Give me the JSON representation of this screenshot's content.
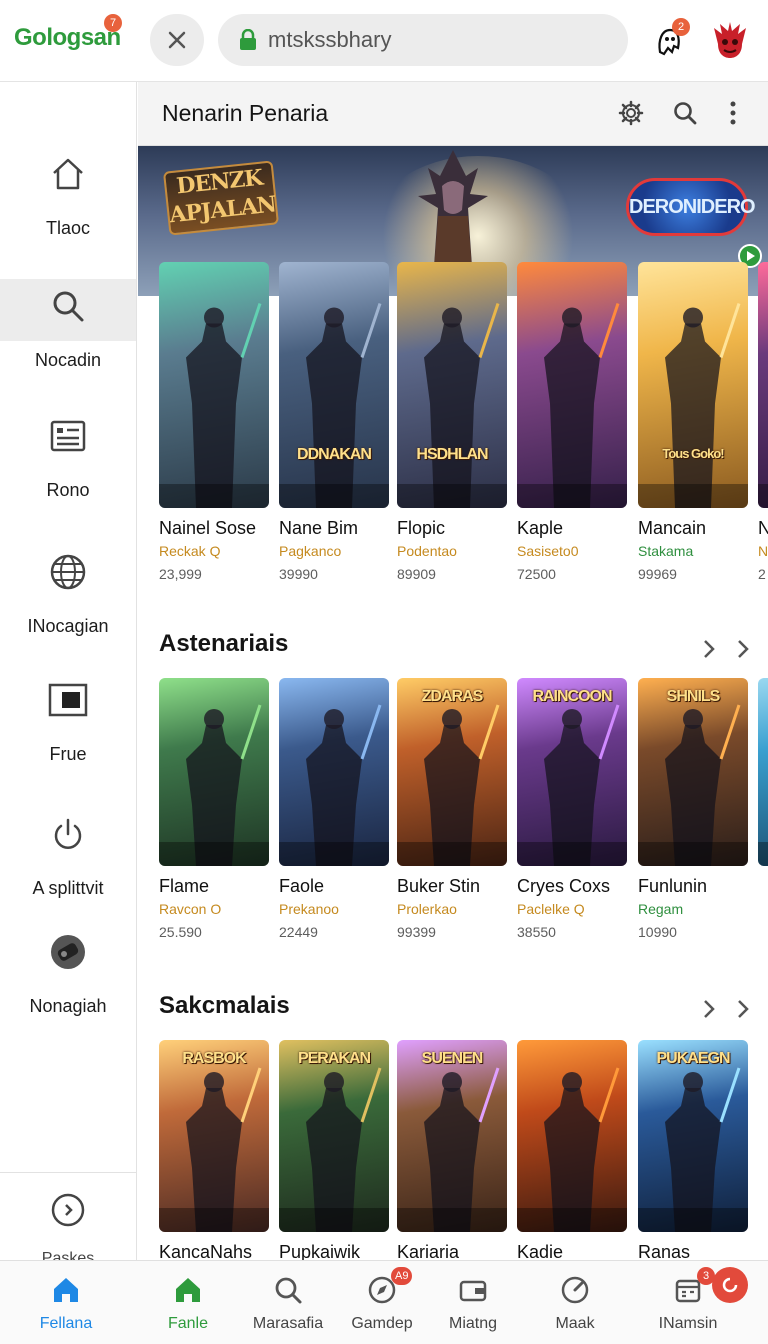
{
  "topbar": {
    "logo": "Gologsan",
    "logo_badge": "7",
    "url": "mtskssbhary",
    "notif_badge": "2"
  },
  "sidebar": {
    "items": [
      {
        "label": "Tlaoc",
        "icon": "home-icon"
      },
      {
        "label": "Nocadin",
        "icon": "search-icon"
      },
      {
        "label": "Rono",
        "icon": "list-card-icon"
      },
      {
        "label": "INocagian",
        "icon": "globe-icon"
      },
      {
        "label": "Frue",
        "icon": "window-icon"
      },
      {
        "label": "A splittvit",
        "icon": "power-icon"
      },
      {
        "label": "Nonagiah",
        "icon": "controller-icon"
      }
    ],
    "footer_label": "Paskes"
  },
  "header": {
    "title": "Nenarin Penaria"
  },
  "hero": {
    "logo_left": "DENZK APJALAN",
    "logo_right": "DERONIDERO"
  },
  "sections": [
    {
      "title": "",
      "cards": [
        {
          "title": "Nainel Sose",
          "sub": "Reckak Q",
          "count": "23,999",
          "art": "",
          "palette": [
            "#5a7c8f",
            "#2b3a48",
            "#62d1b2"
          ]
        },
        {
          "title": "Nane Bim",
          "sub": "Pagkanco",
          "count": "39990",
          "art": "DDNAKAN",
          "palette": [
            "#49607f",
            "#27344a",
            "#a0b4d0"
          ]
        },
        {
          "title": "Flopic",
          "sub": "Podentao",
          "count": "89909",
          "art": "HSDHLAN",
          "palette": [
            "#5e6a8c",
            "#2c2f46",
            "#e9b64a"
          ]
        },
        {
          "title": "Kaple",
          "sub": "Sasiseto0",
          "count": "72500",
          "art": "",
          "palette": [
            "#8a4a8e",
            "#35204a",
            "#ff8a3c"
          ]
        },
        {
          "title": "Mancain",
          "sub": "Stakama",
          "count": "99969",
          "art": "Tous Goko!",
          "palette": [
            "#f0b64a",
            "#8a5a20",
            "#ffe49a"
          ],
          "green": true
        },
        {
          "title": "N",
          "sub": "N",
          "count": "2",
          "art": "",
          "palette": [
            "#6a3a7c",
            "#301a40",
            "#ff6b9a"
          ]
        }
      ]
    },
    {
      "title": "Astenariais",
      "cards": [
        {
          "title": "Flame",
          "sub": "Ravcon O",
          "count": "25.590",
          "art": "",
          "palette": [
            "#3f7a4c",
            "#1e3424",
            "#8fe08a"
          ]
        },
        {
          "title": "Faole",
          "sub": "Prekanoo",
          "count": "22449",
          "art": "",
          "palette": [
            "#3b5a8c",
            "#1a2540",
            "#8ab8f0"
          ]
        },
        {
          "title": "Buker Stin",
          "sub": "Prolerkao",
          "count": "99399",
          "art": "ZDARAS",
          "palette": [
            "#c0602a",
            "#4a2414",
            "#ffcc66"
          ]
        },
        {
          "title": "Cryes Coxs",
          "sub": "Paclelke Q",
          "count": "38550",
          "art": "RAINCOON",
          "palette": [
            "#6a3a8c",
            "#2a1a40",
            "#d08aff"
          ]
        },
        {
          "title": "Funlunin",
          "sub": "Regam",
          "count": "10990",
          "art": "SHNILS",
          "palette": [
            "#7a4a2a",
            "#2a1e1a",
            "#ffb050"
          ],
          "green": true
        },
        {
          "title": "",
          "sub": "",
          "count": "",
          "art": "",
          "palette": [
            "#3aa0d0",
            "#1a4a6a",
            "#9ad8f0"
          ]
        }
      ]
    },
    {
      "title": "Sakcmalais",
      "cards": [
        {
          "title": "KancaNahs",
          "sub": "",
          "count": "",
          "art": "RASBOK",
          "palette": [
            "#c06a3a",
            "#4a2a24",
            "#ffd07a"
          ]
        },
        {
          "title": "Pupkaiwik",
          "sub": "",
          "count": "",
          "art": "PERAKAN",
          "palette": [
            "#3a6a3a",
            "#1e2a1e",
            "#e0c060"
          ]
        },
        {
          "title": "Kariaria",
          "sub": "",
          "count": "",
          "art": "SUENEN",
          "palette": [
            "#8a5a3a",
            "#3a2418",
            "#e0a0ff"
          ]
        },
        {
          "title": "Kadie",
          "sub": "",
          "count": "",
          "art": "",
          "palette": [
            "#c04a1a",
            "#3a1a10",
            "#ff9a3a"
          ]
        },
        {
          "title": "Ranas",
          "sub": "",
          "count": "",
          "art": "PUKAEGN",
          "palette": [
            "#2a5a9a",
            "#10203a",
            "#9ae0ff"
          ]
        }
      ]
    }
  ],
  "bottom_nav": {
    "items": [
      {
        "label": "Fellana",
        "icon": "home-icon",
        "color": "#1e88e5",
        "active": true
      },
      {
        "label": "Fanle",
        "icon": "home-icon",
        "color": "#2e9b3c"
      },
      {
        "label": "Marasafia",
        "icon": "search-icon",
        "color": "#555555"
      },
      {
        "label": "Gamdep",
        "icon": "compass-icon",
        "color": "#555555",
        "badge": "A9"
      },
      {
        "label": "Miatng",
        "icon": "wallet-icon",
        "color": "#555555"
      },
      {
        "label": "Maak",
        "icon": "gauge-icon",
        "color": "#555555"
      },
      {
        "label": "INamsin",
        "icon": "calendar-icon",
        "color": "#555555",
        "badge": "3"
      }
    ]
  },
  "colors": {
    "brand_green": "#2e9b3c",
    "accent_blue": "#1e88e5",
    "badge_orange": "#e8623c",
    "sub_gold": "#c58a1f"
  }
}
